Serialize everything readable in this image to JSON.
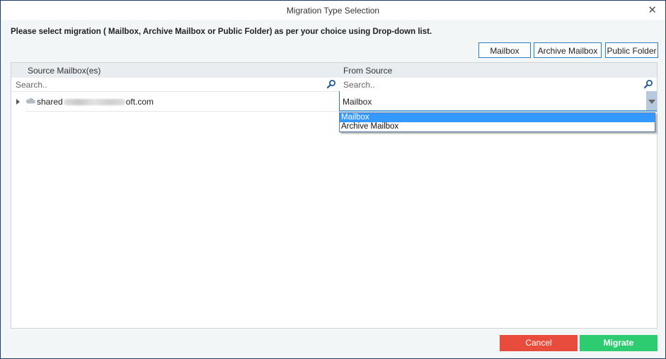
{
  "window": {
    "title": "Migration Type Selection",
    "close_label": "✕"
  },
  "instruction": "Please select migration ( Mailbox, Archive Mailbox or Public Folder) as per your choice using Drop-down list.",
  "type_buttons": [
    {
      "label": "Mailbox"
    },
    {
      "label": "Archive Mailbox"
    },
    {
      "label": "Public Folder"
    }
  ],
  "grid": {
    "columns": [
      {
        "header": "Source Mailbox(es)",
        "search_placeholder": "Search.."
      },
      {
        "header": "From Source",
        "search_placeholder": "Search.."
      }
    ],
    "rows": [
      {
        "mailbox_prefix": "shared",
        "mailbox_suffix": "oft.com",
        "from_source": "Mailbox"
      }
    ]
  },
  "dropdown": {
    "options": [
      {
        "label": "Mailbox",
        "selected": true
      },
      {
        "label": "Archive Mailbox",
        "selected": false
      }
    ]
  },
  "footer": {
    "cancel_label": "Cancel",
    "migrate_label": "Migrate"
  },
  "colors": {
    "accent_border": "#2a7fc3",
    "cancel": "#e74c3c",
    "migrate": "#2ecc71",
    "selection": "#3399ff",
    "window_frame": "#1f3e6e"
  }
}
